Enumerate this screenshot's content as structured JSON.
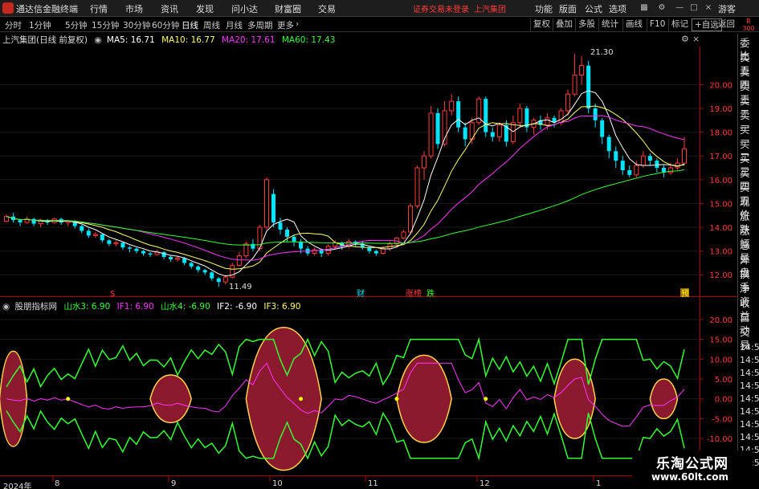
{
  "app": {
    "title": "通达信金融终端",
    "menu": [
      "行情",
      "市场",
      "资讯",
      "发现",
      "问小达",
      "财富圈",
      "交易"
    ],
    "status": "证券交易未登录",
    "status_stock": "上汽集团",
    "right_menu": [
      "功能",
      "版面",
      "公式",
      "选项"
    ],
    "guest": "游客"
  },
  "colors": {
    "up": "#ff3b3b",
    "down": "#00e5ff",
    "ma5": "#ffffff",
    "ma10": "#ffff66",
    "ma20": "#ff33ff",
    "ma60": "#33ff33",
    "fill": "#8b1a2e"
  },
  "periods": [
    "分时",
    "1分钟",
    "5分钟",
    "15分钟",
    "30分钟",
    "60分钟",
    "日线",
    "周线",
    "月线",
    "多周期",
    "更多"
  ],
  "active_period": "日线",
  "tools": [
    "复权",
    "叠加",
    "多股",
    "统计",
    "画线",
    "F10",
    "标记",
    "+自选",
    "返回"
  ],
  "scale_label": {
    "r": "R",
    "n": "300"
  },
  "main_legend": {
    "title": "上汽集团(日线 前复权)",
    "ma5": "MA5: 16.71",
    "ma10": "MA10: 16.77",
    "ma20": "MA20: 17.61",
    "ma60": "MA60: 17.43"
  },
  "sub_legend": {
    "title": "股朋指标网",
    "shanshui3": "山水3: 6.90",
    "if1": "IF1: 6.90",
    "shanshui4": "山水4: -6.90",
    "if2": "IF2: -6.90",
    "if3": "IF3: 6.90"
  },
  "price_axis": {
    "labels": [
      "20.00",
      "19.00",
      "18.00",
      "17.00",
      "16.00",
      "15.00",
      "14.00",
      "13.00",
      "12.00"
    ]
  },
  "indicator_axis": {
    "labels": [
      "20.00",
      "15.00",
      "10.00",
      "5.00",
      "0.00",
      "-5.00",
      "-10.00"
    ]
  },
  "annotations": {
    "high": "21.30",
    "low": "11.49"
  },
  "event_markers": [
    {
      "label": "S",
      "color": "#ff3b3b"
    },
    {
      "label": "财",
      "color": "#00e5ff"
    },
    {
      "label": "涨榜",
      "color": "#ff3b3b"
    },
    {
      "label": "跌",
      "color": "#33ff33"
    },
    {
      "label": "预",
      "color": "#ffff00"
    }
  ],
  "xaxis": [
    "2024年",
    "8",
    "9",
    "10",
    "11",
    "12",
    "1"
  ],
  "side_panel": {
    "items": [
      "委比",
      "卖五",
      "卖四",
      "卖三",
      "卖二",
      "卖一",
      "买一",
      "买二",
      "买三",
      "买四",
      "买五",
      "现价",
      "涨跌",
      "涨幅",
      "总量",
      "外盘",
      "换手",
      "净资",
      "收益",
      "自动",
      "交易"
    ],
    "times": [
      "14:56",
      "14:56",
      "14:56",
      "14:56",
      "14:56",
      "14:56",
      "14:56",
      "14:56",
      "14:56",
      "14:56"
    ]
  },
  "watermark": {
    "cn": "乐淘公式网",
    "url": "www.60lt.com"
  },
  "chart_data": {
    "type": "candlestick",
    "price_ylim": [
      11.4,
      21.6
    ],
    "indicator_ylim": [
      -12,
      22
    ],
    "candles": [
      [
        14.25,
        14.45,
        14.55,
        14.2
      ],
      [
        14.45,
        14.3,
        14.6,
        14.2
      ],
      [
        14.3,
        14.2,
        14.35,
        14.05
      ],
      [
        14.2,
        14.35,
        14.45,
        14.15
      ],
      [
        14.35,
        14.15,
        14.4,
        14.05
      ],
      [
        14.15,
        14.3,
        14.35,
        14.0
      ],
      [
        14.3,
        14.2,
        14.35,
        14.1
      ],
      [
        14.2,
        14.35,
        14.4,
        14.15
      ],
      [
        14.35,
        14.2,
        14.4,
        14.1
      ],
      [
        14.2,
        14.25,
        14.3,
        14.05
      ],
      [
        14.25,
        14.05,
        14.3,
        13.95
      ],
      [
        14.05,
        13.85,
        14.1,
        13.75
      ],
      [
        13.85,
        13.65,
        13.95,
        13.55
      ],
      [
        13.65,
        13.7,
        13.8,
        13.55
      ],
      [
        13.7,
        13.45,
        13.75,
        13.35
      ],
      [
        13.45,
        13.3,
        13.5,
        13.2
      ],
      [
        13.3,
        13.35,
        13.45,
        13.2
      ],
      [
        13.35,
        13.15,
        13.4,
        13.05
      ],
      [
        13.15,
        13.1,
        13.2,
        12.95
      ],
      [
        13.1,
        13.0,
        13.15,
        12.9
      ],
      [
        13.0,
        12.9,
        13.05,
        12.8
      ],
      [
        12.9,
        12.85,
        12.95,
        12.75
      ],
      [
        12.85,
        12.95,
        13.05,
        12.8
      ],
      [
        12.95,
        12.75,
        13.0,
        12.65
      ],
      [
        12.75,
        12.65,
        12.8,
        12.55
      ],
      [
        12.65,
        12.7,
        12.8,
        12.55
      ],
      [
        12.7,
        12.5,
        12.75,
        12.4
      ],
      [
        12.5,
        12.35,
        12.55,
        12.25
      ],
      [
        12.35,
        12.2,
        12.4,
        12.1
      ],
      [
        12.2,
        12.1,
        12.25,
        12.0
      ],
      [
        12.1,
        11.85,
        12.15,
        11.75
      ],
      [
        11.85,
        11.7,
        11.9,
        11.49
      ],
      [
        11.7,
        11.9,
        12.0,
        11.6
      ],
      [
        11.9,
        12.4,
        12.5,
        11.85
      ],
      [
        12.4,
        12.8,
        12.95,
        12.35
      ],
      [
        12.8,
        13.3,
        13.4,
        12.7
      ],
      [
        13.3,
        13.1,
        13.5,
        13.0
      ],
      [
        13.1,
        14.0,
        14.1,
        13.0
      ],
      [
        14.0,
        16.0,
        16.1,
        13.9
      ],
      [
        15.4,
        14.2,
        15.6,
        14.0
      ],
      [
        14.2,
        13.9,
        14.4,
        13.7
      ],
      [
        13.9,
        13.6,
        14.0,
        13.4
      ],
      [
        13.6,
        13.4,
        13.7,
        13.2
      ],
      [
        13.4,
        13.1,
        13.5,
        12.9
      ],
      [
        13.1,
        12.9,
        13.2,
        12.8
      ],
      [
        12.9,
        13.05,
        13.15,
        12.8
      ],
      [
        13.05,
        12.9,
        13.1,
        12.75
      ],
      [
        12.9,
        13.2,
        13.3,
        12.8
      ],
      [
        13.2,
        13.35,
        13.45,
        13.05
      ],
      [
        13.35,
        13.2,
        13.4,
        13.05
      ],
      [
        13.2,
        13.4,
        13.5,
        13.1
      ],
      [
        13.4,
        13.3,
        13.45,
        13.15
      ],
      [
        13.3,
        13.15,
        13.4,
        13.05
      ],
      [
        13.15,
        13.0,
        13.2,
        12.9
      ],
      [
        13.0,
        12.9,
        13.05,
        12.8
      ],
      [
        12.9,
        13.1,
        13.2,
        12.85
      ],
      [
        13.1,
        13.3,
        13.4,
        13.0
      ],
      [
        13.3,
        13.55,
        13.6,
        13.2
      ],
      [
        13.55,
        13.8,
        13.9,
        13.5
      ],
      [
        13.8,
        14.9,
        15.0,
        13.7
      ],
      [
        14.9,
        16.5,
        16.6,
        14.8
      ],
      [
        16.5,
        17.0,
        17.2,
        16.0
      ],
      [
        17.0,
        18.8,
        19.1,
        16.9
      ],
      [
        18.8,
        17.5,
        19.0,
        17.3
      ],
      [
        17.5,
        18.9,
        19.3,
        17.4
      ],
      [
        18.9,
        19.3,
        19.6,
        18.7
      ],
      [
        19.3,
        18.2,
        19.5,
        18.0
      ],
      [
        18.2,
        17.7,
        18.4,
        17.4
      ],
      [
        17.7,
        18.4,
        18.6,
        17.5
      ],
      [
        18.4,
        19.4,
        19.5,
        18.3
      ],
      [
        19.4,
        18.0,
        19.5,
        17.8
      ],
      [
        18.0,
        17.8,
        18.2,
        17.6
      ],
      [
        17.8,
        18.3,
        18.4,
        17.6
      ],
      [
        18.3,
        17.6,
        18.5,
        17.4
      ],
      [
        17.6,
        18.4,
        18.7,
        17.5
      ],
      [
        18.4,
        19.0,
        19.2,
        18.2
      ],
      [
        19.0,
        18.2,
        19.1,
        18.0
      ],
      [
        18.2,
        18.5,
        18.6,
        17.9
      ],
      [
        18.5,
        18.3,
        18.7,
        18.1
      ],
      [
        18.3,
        18.6,
        18.8,
        18.1
      ],
      [
        18.6,
        18.4,
        18.7,
        18.2
      ],
      [
        18.4,
        18.9,
        19.0,
        18.3
      ],
      [
        18.9,
        19.6,
        19.8,
        18.7
      ],
      [
        19.6,
        20.4,
        21.3,
        19.5
      ],
      [
        20.4,
        20.8,
        21.2,
        20.0
      ],
      [
        20.8,
        19.0,
        21.0,
        18.8
      ],
      [
        19.0,
        18.5,
        19.2,
        18.2
      ],
      [
        18.5,
        17.8,
        18.6,
        17.5
      ],
      [
        17.8,
        17.2,
        17.9,
        16.9
      ],
      [
        17.2,
        16.8,
        17.4,
        16.5
      ],
      [
        16.8,
        16.4,
        17.0,
        16.2
      ],
      [
        16.4,
        16.2,
        16.6,
        16.1
      ],
      [
        16.2,
        16.6,
        16.8,
        16.1
      ],
      [
        16.6,
        17.0,
        17.2,
        16.5
      ],
      [
        17.0,
        16.8,
        17.1,
        16.6
      ],
      [
        16.8,
        16.5,
        16.9,
        16.3
      ],
      [
        16.5,
        16.3,
        16.6,
        16.1
      ],
      [
        16.3,
        16.5,
        16.7,
        16.2
      ],
      [
        16.5,
        16.7,
        16.9,
        16.4
      ],
      [
        16.7,
        17.3,
        17.8,
        16.6
      ]
    ]
  }
}
